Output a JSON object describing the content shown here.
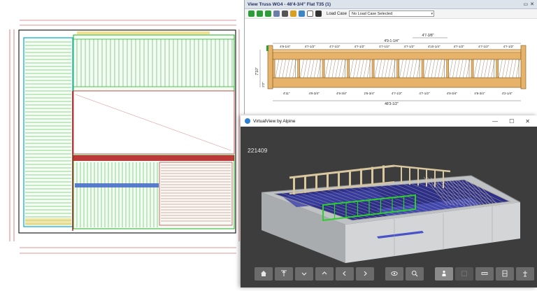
{
  "truss_window": {
    "title": "View Truss  WG4 - 48'4-3/4\"  Flat T35 (1)",
    "close": "✕",
    "toolbar": {
      "load_case_label": "Load Case",
      "load_case_value": "No Load Case Selected"
    },
    "dims": {
      "top_span": "4'7-3/8\"",
      "overall_top": "4'9-1-1/4\"",
      "top_panels": [
        "4'9-1/4\"",
        "4'7-1/2\"",
        "4'7-1/2\"",
        "4'7-1/2\"",
        "4'7-1/2\"",
        "4'7-1/2\"",
        "4'10-1/4\"",
        "4'7-1/2\"",
        "4'7-1/2\"",
        "4'7-1/2\""
      ],
      "bottom_panels": [
        "4'11\"",
        "4'9-3/4\"",
        "4'9-3/4\"",
        "2'6-3/4\"",
        "4'7-1/2\"",
        "4'7-1/2\"",
        "4'9-3/4\"",
        "4'9-3/4\"",
        "4'2-1/4\""
      ],
      "overall_bottom": "48'3-1/2\"",
      "height": "7'10\"",
      "left_height": "2'2\""
    }
  },
  "vv_window": {
    "title": "VirtualView by Alpine",
    "job_number": "221409",
    "min": "—",
    "max": "☐",
    "close": "✕"
  },
  "vv_toolbar": {
    "buttons": [
      "home-icon",
      "level-top-icon",
      "chevron-down-icon",
      "chevron-up-icon",
      "chevron-left-icon",
      "chevron-right-icon",
      "eye-icon",
      "zoom-icon",
      "person-icon",
      "grid-icon",
      "ruler-icon",
      "split-icon",
      "upright-icon"
    ]
  },
  "colors": {
    "plan_green": "#1fb21f",
    "plan_cyan": "#22b8cf",
    "plan_red": "#b01818",
    "truss_wood": "#e7b36a",
    "vv_bg": "#3d3d3d",
    "vv_blue_floor": "#2b2e8a"
  }
}
